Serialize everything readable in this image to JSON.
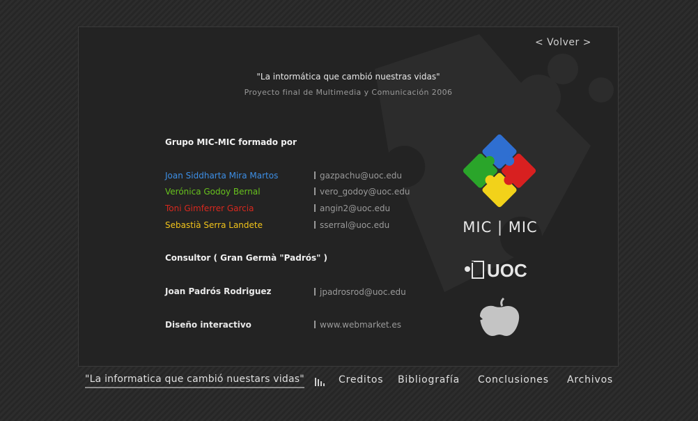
{
  "panel": {
    "back_label": "< Volver >",
    "quote_title": "\"La intormática que cambió nuestras vidas\"",
    "subtitle": "Proyecto final de Multimedia y Comunicación 2006",
    "group_heading": "Grupo MIC-MIC formado por",
    "members": [
      {
        "name": "Joan Siddharta Mira Martos",
        "email": "gazpachu@uoc.edu",
        "color": "#3d8fe6"
      },
      {
        "name": "Verónica Godoy Bernal",
        "email": "vero_godoy@uoc.edu",
        "color": "#68c21e"
      },
      {
        "name": "Toni Gimferrer Garcia",
        "email": "angin2@uoc.edu",
        "color": "#d8281e"
      },
      {
        "name": "Sebastià Serra Landete",
        "email": "sserral@uoc.edu",
        "color": "#f2c41a"
      }
    ],
    "consultant_heading": "Consultor ( Gran Germà \"Padrós\" )",
    "consultant": {
      "name": "Joan Padrós Rodriguez",
      "email": "jpadrosrod@uoc.edu"
    },
    "design": {
      "label": "Diseño interactivo",
      "site": "www.webmarket.es"
    },
    "logos": {
      "mic": "MIC | MIC",
      "uoc": "UOC",
      "puzzle_icon": "puzzle-logo-icon",
      "apple_icon": "apple-icon"
    }
  },
  "footer": {
    "title": "\"La informatica que cambió nuestars vidas\"",
    "icon": "bars-icon",
    "nav": [
      "Creditos",
      "Bibliografía",
      "Conclusiones",
      "Archivos"
    ]
  }
}
